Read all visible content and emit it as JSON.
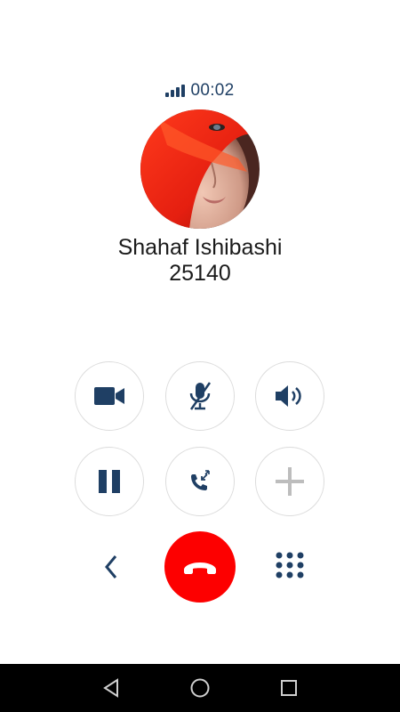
{
  "call": {
    "duration": "00:02",
    "contact_name": "Shahaf Ishibashi",
    "contact_number": "25140"
  },
  "controls": {
    "row1": [
      "video-icon",
      "mute-mic-icon",
      "speaker-icon"
    ],
    "row2": [
      "pause-icon",
      "transfer-call-icon",
      "add-call-icon"
    ],
    "row3": [
      "back-chevron-icon",
      "end-call-icon",
      "dialpad-icon"
    ]
  },
  "colors": {
    "accent": "#1f3f64",
    "hangup": "#fd0000",
    "disabled": "#bdbdbd",
    "circle_border": "#dcdcdc",
    "navbar": "#000000"
  },
  "navbar": {
    "buttons": [
      "nav-back-icon",
      "nav-home-icon",
      "nav-recents-icon"
    ]
  }
}
